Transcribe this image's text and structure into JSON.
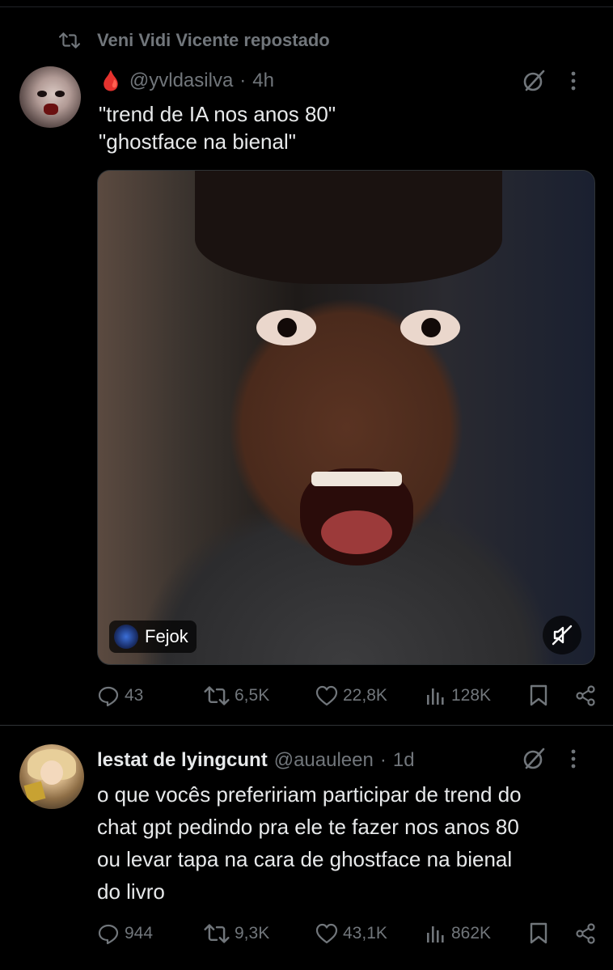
{
  "repost": {
    "label": "Veni Vidi Vicente repostado"
  },
  "tweet1": {
    "emoji": "🩸",
    "handle": "@yvldasilva",
    "dot": "·",
    "time": "4h",
    "text_lines": [
      "\"trend de IA nos anos 80\"",
      "\"ghostface na bienal\""
    ],
    "media": {
      "caption_user": "Fejok"
    },
    "stats": {
      "replies": "43",
      "reposts": "6,5K",
      "likes": "22,8K",
      "views": "128K"
    }
  },
  "tweet2": {
    "name": "lestat de lyingcunt",
    "handle": "@auauleen",
    "dot": "·",
    "time": "1d",
    "text_lines": [
      "o que vocês prefeririam participar de trend do",
      "chat gpt pedindo pra ele te fazer nos anos 80",
      "ou levar tapa na cara de ghostface na bienal",
      "do livro"
    ],
    "stats": {
      "replies": "944",
      "reposts": "9,3K",
      "likes": "43,1K",
      "views": "862K"
    }
  },
  "icons": {
    "repost": "repost-icon",
    "grok": "grok-icon",
    "more": "more-icon",
    "reply": "reply-icon",
    "like": "heart-icon",
    "views": "views-icon",
    "bookmark": "bookmark-icon",
    "share": "share-icon",
    "mute": "muted-speaker-icon"
  },
  "colors": {
    "background": "#000000",
    "text": "#e7e9ea",
    "muted": "#71767b",
    "divider": "#2f3336"
  }
}
